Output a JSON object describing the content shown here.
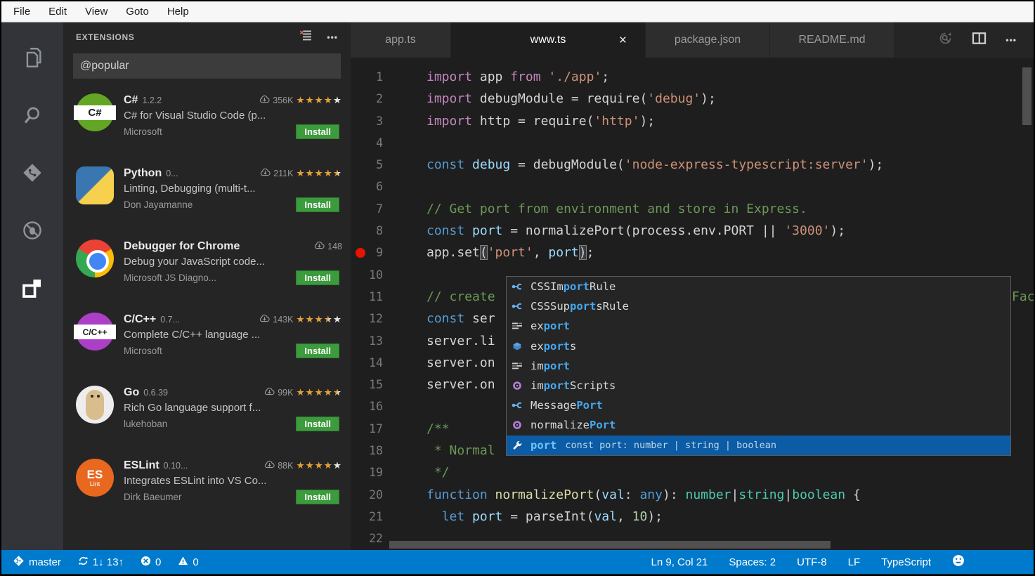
{
  "menu": {
    "items": [
      "File",
      "Edit",
      "View",
      "Goto",
      "Help"
    ]
  },
  "activity_bar": {
    "items": [
      "explorer",
      "search",
      "source-control",
      "debug",
      "extensions"
    ],
    "active": "extensions"
  },
  "sidebar": {
    "title": "EXTENSIONS",
    "search": {
      "value": "@popular"
    },
    "extensions": [
      {
        "name": "C#",
        "version": "1.2.2",
        "downloads": "356K",
        "rating": 4,
        "description": "C# for Visual Studio Code (p...",
        "author": "Microsoft",
        "action": "Install",
        "icon": "csharp",
        "icon_text": "C#"
      },
      {
        "name": "Python",
        "version": "0...",
        "downloads": "211K",
        "rating": 4.5,
        "description": "Linting, Debugging (multi-t...",
        "author": "Don Jayamanne",
        "action": "Install",
        "icon": "python",
        "icon_text": ""
      },
      {
        "name": "Debugger for Chrome",
        "version": "",
        "downloads": "148",
        "rating": null,
        "description": "Debug your JavaScript code...",
        "author": "Microsoft JS Diagno...",
        "action": "Install",
        "icon": "chrome",
        "icon_text": ""
      },
      {
        "name": "C/C++",
        "version": "0.7...",
        "downloads": "143K",
        "rating": 3.5,
        "description": "Complete C/C++ language ...",
        "author": "Microsoft",
        "action": "Install",
        "icon": "cpp",
        "icon_text": "C/C++"
      },
      {
        "name": "Go",
        "version": "0.6.39",
        "downloads": "99K",
        "rating": 4.5,
        "description": "Rich Go language support f...",
        "author": "lukehoban",
        "action": "Install",
        "icon": "go",
        "icon_text": ""
      },
      {
        "name": "ESLint",
        "version": "0.10...",
        "downloads": "88K",
        "rating": 4,
        "description": "Integrates ESLint into VS Co...",
        "author": "Dirk Baeumer",
        "action": "Install",
        "icon": "eslint",
        "icon_text": ""
      }
    ]
  },
  "editor": {
    "tabs": [
      {
        "label": "app.ts",
        "state": "inactive"
      },
      {
        "label": "www.ts",
        "state": "active",
        "close": "×"
      },
      {
        "label": "package.json",
        "state": "inactive"
      },
      {
        "label": "README.md",
        "state": "inactive"
      }
    ],
    "code": {
      "overflow_fragment": "Fac",
      "lines": [
        {
          "n": 1,
          "t": [
            [
              "import",
              "k"
            ],
            [
              " app ",
              "p"
            ],
            [
              "from",
              "k"
            ],
            [
              " ",
              "p"
            ],
            [
              "'./app'",
              "s"
            ],
            [
              ";",
              "p"
            ]
          ]
        },
        {
          "n": 2,
          "t": [
            [
              "import",
              "k"
            ],
            [
              " debugModule = require(",
              "p"
            ],
            [
              "'debug'",
              "s"
            ],
            [
              ");",
              "p"
            ]
          ]
        },
        {
          "n": 3,
          "t": [
            [
              "import",
              "k"
            ],
            [
              " http = require(",
              "p"
            ],
            [
              "'http'",
              "s"
            ],
            [
              ");",
              "p"
            ]
          ]
        },
        {
          "n": 4,
          "t": []
        },
        {
          "n": 5,
          "t": [
            [
              "const",
              "b"
            ],
            [
              " debug",
              "v"
            ],
            [
              " = debugModule(",
              "p"
            ],
            [
              "'node-express-typescript:server'",
              "s"
            ],
            [
              ");",
              "p"
            ]
          ]
        },
        {
          "n": 6,
          "t": []
        },
        {
          "n": 7,
          "t": [
            [
              "// Get port from environment and store in Express.",
              "c"
            ]
          ]
        },
        {
          "n": 8,
          "t": [
            [
              "const",
              "b"
            ],
            [
              " port",
              "v"
            ],
            [
              " = normalizePort(process.env.PORT || ",
              "p"
            ],
            [
              "'3000'",
              "s"
            ],
            [
              ");",
              "p"
            ]
          ]
        },
        {
          "n": 9,
          "t": [
            [
              "app.set",
              "p"
            ],
            [
              "(",
              "bh"
            ],
            [
              "'port'",
              "s"
            ],
            [
              ", ",
              "p"
            ],
            [
              "port",
              "v"
            ],
            [
              ")",
              "bh"
            ],
            [
              ";",
              "p"
            ]
          ],
          "bp": true
        },
        {
          "n": 10,
          "t": []
        },
        {
          "n": 11,
          "t": [
            [
              "// create ",
              "c"
            ]
          ]
        },
        {
          "n": 12,
          "t": [
            [
              "const",
              "b"
            ],
            [
              " ser",
              "p"
            ]
          ]
        },
        {
          "n": 13,
          "t": [
            [
              "server.li",
              "p"
            ]
          ]
        },
        {
          "n": 14,
          "t": [
            [
              "server.on",
              "p"
            ]
          ]
        },
        {
          "n": 15,
          "t": [
            [
              "server.on",
              "p"
            ]
          ]
        },
        {
          "n": 16,
          "t": []
        },
        {
          "n": 17,
          "t": [
            [
              "/**",
              "c"
            ]
          ]
        },
        {
          "n": 18,
          "t": [
            [
              " * Normal",
              "c"
            ]
          ]
        },
        {
          "n": 19,
          "t": [
            [
              " */",
              "c"
            ]
          ]
        },
        {
          "n": 20,
          "t": [
            [
              "function",
              "b"
            ],
            [
              " normalizePort",
              "f"
            ],
            [
              "(",
              "p"
            ],
            [
              "val",
              "v"
            ],
            [
              ": ",
              "p"
            ],
            [
              "any",
              "b"
            ],
            [
              "): ",
              "p"
            ],
            [
              "number",
              "t"
            ],
            [
              "|",
              "p"
            ],
            [
              "string",
              "t"
            ],
            [
              "|",
              "p"
            ],
            [
              "boolean",
              "t"
            ],
            [
              " {",
              "p"
            ]
          ]
        },
        {
          "n": 21,
          "t": [
            [
              "  ",
              "p"
            ],
            [
              "let",
              "b"
            ],
            [
              " port",
              "v"
            ],
            [
              " = parseInt(",
              "p"
            ],
            [
              "val",
              "v"
            ],
            [
              ", ",
              "p"
            ],
            [
              "10",
              "n"
            ],
            [
              ");",
              "p"
            ]
          ]
        },
        {
          "n": 22,
          "t": []
        }
      ]
    },
    "suggest": {
      "items": [
        {
          "icon": "class",
          "pre": "CSSIm",
          "match": "port",
          "post": "Rule"
        },
        {
          "icon": "class",
          "pre": "CSSSup",
          "match": "port",
          "post": "sRule"
        },
        {
          "icon": "keyword",
          "pre": "ex",
          "match": "port",
          "post": ""
        },
        {
          "icon": "field",
          "pre": "ex",
          "match": "port",
          "post": "s"
        },
        {
          "icon": "keyword",
          "pre": "im",
          "match": "port",
          "post": ""
        },
        {
          "icon": "method",
          "pre": "im",
          "match": "port",
          "post": "Scripts"
        },
        {
          "icon": "class",
          "pre": "Message",
          "match": "Port",
          "post": ""
        },
        {
          "icon": "method",
          "pre": "normalize",
          "match": "Port",
          "post": ""
        },
        {
          "icon": "wrench",
          "pre": "",
          "match": "port",
          "post": "",
          "detail": "const port: number | string | boolean",
          "selected": true
        }
      ]
    }
  },
  "status_bar": {
    "accent": "#007acc",
    "left": [
      {
        "icon": "git-branch",
        "label": "master"
      },
      {
        "icon": "sync",
        "label": "1↓ 13↑"
      },
      {
        "icon": "error",
        "label": "0"
      },
      {
        "icon": "warning",
        "label": "0"
      }
    ],
    "right": [
      "Ln 9, Col 21",
      "Spaces: 2",
      "UTF-8",
      "LF",
      "TypeScript"
    ]
  }
}
